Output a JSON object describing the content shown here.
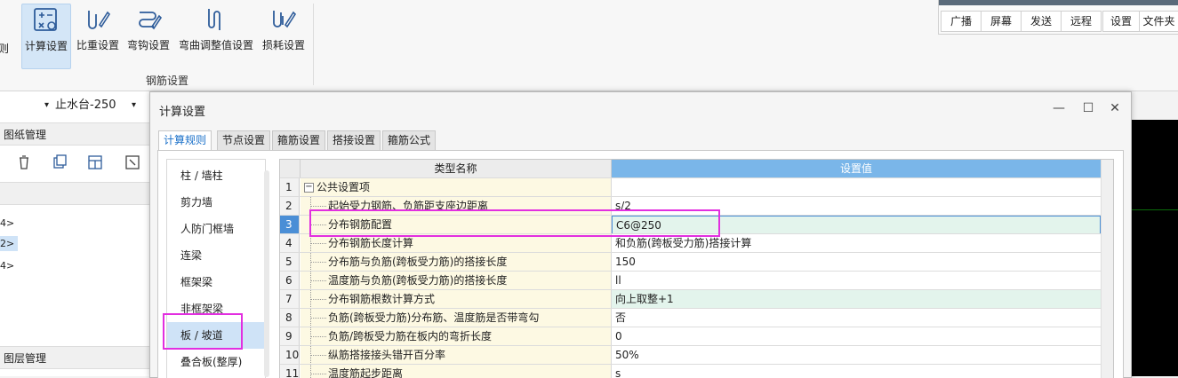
{
  "ribbon": {
    "left_cut_label": "则",
    "buttons": [
      {
        "label": "计算设置",
        "icon": "calc-settings-icon",
        "active": true
      },
      {
        "label": "比重设置",
        "icon": "weight-settings-icon"
      },
      {
        "label": "弯钩设置",
        "icon": "hook-settings-icon"
      },
      {
        "label": "弯曲调整值设置",
        "icon": "bend-adjust-icon"
      },
      {
        "label": "损耗设置",
        "icon": "loss-settings-icon"
      }
    ],
    "group_label": "钢筋设置"
  },
  "mini_toolbar": {
    "buttons": [
      "广播",
      "屏幕",
      "发送",
      "远程",
      "设置",
      "文件夹"
    ]
  },
  "left_pane": {
    "combo_value": "止水台-250",
    "drawing_manager": "图纸管理",
    "layer_manager": "图层管理",
    "tree_items": [
      "4>",
      "2>",
      "4>"
    ]
  },
  "dialog": {
    "title": "计算设置",
    "controls": {
      "minimize": "—",
      "maximize": "☐",
      "close": "✕"
    },
    "tabs": [
      "计算规则",
      "节点设置",
      "箍筋设置",
      "搭接设置",
      "箍筋公式"
    ],
    "categories": [
      "柱 / 墙柱",
      "剪力墙",
      "人防门框墙",
      "连梁",
      "框架梁",
      "非框架梁",
      "板 / 坡道",
      "叠合板(整厚)"
    ],
    "selected_category": 6,
    "grid": {
      "headers": {
        "name": "类型名称",
        "value": "设置值"
      },
      "rows": [
        {
          "num": "1",
          "name": "公共设置项",
          "value": "",
          "group": true
        },
        {
          "num": "2",
          "name": "起始受力钢筋、负筋距支座边距离",
          "value": "s/2"
        },
        {
          "num": "3",
          "name": "分布钢筋配置",
          "value": "C6@250",
          "selected": true
        },
        {
          "num": "4",
          "name": "分布钢筋长度计算",
          "value": "和负筋(跨板受力筋)搭接计算"
        },
        {
          "num": "5",
          "name": "分布筋与负筋(跨板受力筋)的搭接长度",
          "value": "150"
        },
        {
          "num": "6",
          "name": "温度筋与负筋(跨板受力筋)的搭接长度",
          "value": "ll"
        },
        {
          "num": "7",
          "name": "分布钢筋根数计算方式",
          "value": "向上取整+1",
          "green": true
        },
        {
          "num": "8",
          "name": "负筋(跨板受力筋)分布筋、温度筋是否带弯勾",
          "value": "否"
        },
        {
          "num": "9",
          "name": "负筋/跨板受力筋在板内的弯折长度",
          "value": "0"
        },
        {
          "num": "10",
          "name": "纵筋搭接接头错开百分率",
          "value": "50%"
        },
        {
          "num": "11",
          "name": "温度筋起步距离",
          "value": "s"
        }
      ]
    }
  },
  "colors": {
    "highlight": "#e22fe0",
    "header_blue": "#7ab6e9",
    "selection": "#4a8ed6"
  }
}
